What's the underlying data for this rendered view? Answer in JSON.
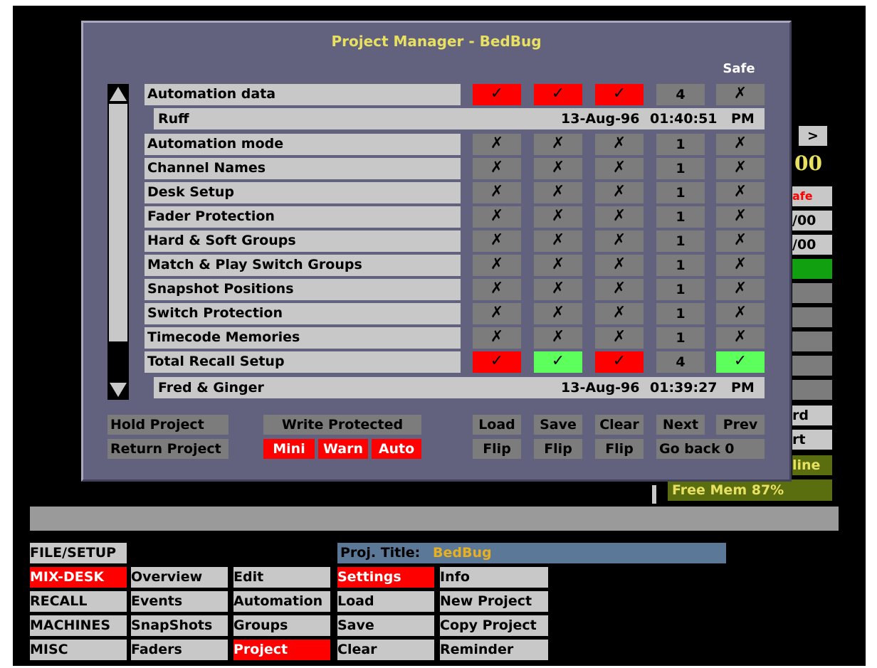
{
  "dialog": {
    "title": "Project Manager - BedBug",
    "safe_header": "Safe",
    "rows": [
      {
        "label": "Automation data",
        "c1": "✓",
        "c2": "✓",
        "c3": "✓",
        "count": "4",
        "safe": "✗"
      },
      {
        "label": "Automation mode",
        "c1": "✗",
        "c2": "✗",
        "c3": "✗",
        "count": "1",
        "safe": "✗"
      },
      {
        "label": "Channel Names",
        "c1": "✗",
        "c2": "✗",
        "c3": "✗",
        "count": "1",
        "safe": "✗"
      },
      {
        "label": "Desk Setup",
        "c1": "✗",
        "c2": "✗",
        "c3": "✗",
        "count": "1",
        "safe": "✗"
      },
      {
        "label": "Fader Protection",
        "c1": "✗",
        "c2": "✗",
        "c3": "✗",
        "count": "1",
        "safe": "✗"
      },
      {
        "label": "Hard & Soft Groups",
        "c1": "✗",
        "c2": "✗",
        "c3": "✗",
        "count": "1",
        "safe": "✗"
      },
      {
        "label": "Match & Play Switch Groups",
        "c1": "✗",
        "c2": "✗",
        "c3": "✗",
        "count": "1",
        "safe": "✗"
      },
      {
        "label": "Snapshot Positions",
        "c1": "✗",
        "c2": "✗",
        "c3": "✗",
        "count": "1",
        "safe": "✗"
      },
      {
        "label": "Switch Protection",
        "c1": "✗",
        "c2": "✗",
        "c3": "✗",
        "count": "1",
        "safe": "✗"
      },
      {
        "label": "Timecode Memories",
        "c1": "✗",
        "c2": "✗",
        "c3": "✗",
        "count": "1",
        "safe": "✗"
      },
      {
        "label": "Total Recall Setup",
        "c1": "✓",
        "c2": "✓",
        "c3": "✓",
        "count": "4",
        "safe": "✓"
      }
    ],
    "detail_top": {
      "name": "Ruff",
      "date": "13-Aug-96",
      "time": "01:40:51",
      "ampm": "PM"
    },
    "detail_bottom": {
      "name": "Fred & Ginger",
      "date": "13-Aug-96",
      "time": "01:39:27",
      "ampm": "PM"
    },
    "buttons": {
      "hold_project": "Hold Project",
      "return_project": "Return Project",
      "write_protected": "Write Protected",
      "mini": "Mini",
      "warn": "Warn",
      "auto": "Auto",
      "load": "Load",
      "save": "Save",
      "clear": "Clear",
      "next": "Next",
      "prev": "Prev",
      "flip1": "Flip",
      "flip2": "Flip",
      "flip3": "Flip",
      "go_back": "Go back 0"
    }
  },
  "side": {
    "arrow": ">",
    "big_num": "00",
    "safe_label": "afe",
    "slash1": "/00",
    "slash2": "/00",
    "rd": "rd",
    "rt": "rt",
    "line": "line",
    "free_mem": "Free Mem 87%"
  },
  "menu": {
    "left": [
      "FILE/SETUP",
      "MIX-DESK",
      "RECALL",
      "MACHINES",
      "MISC"
    ],
    "col2": [
      "Overview",
      "Events",
      "SnapShots",
      "Faders"
    ],
    "col3": [
      "Edit",
      "Automation",
      "Groups",
      "Project"
    ],
    "col4": [
      "Settings",
      "Load",
      "Save",
      "Clear"
    ],
    "col5": [
      "Info",
      "New Project",
      "Copy Project",
      "Reminder"
    ],
    "proj_title_label": "Proj. Title:",
    "proj_title_value": "BedBug"
  },
  "colors": {
    "accent_red": "#ff0000",
    "accent_green": "#5cff5c",
    "title_yellow": "#e8e060",
    "panel": "#62627e"
  }
}
